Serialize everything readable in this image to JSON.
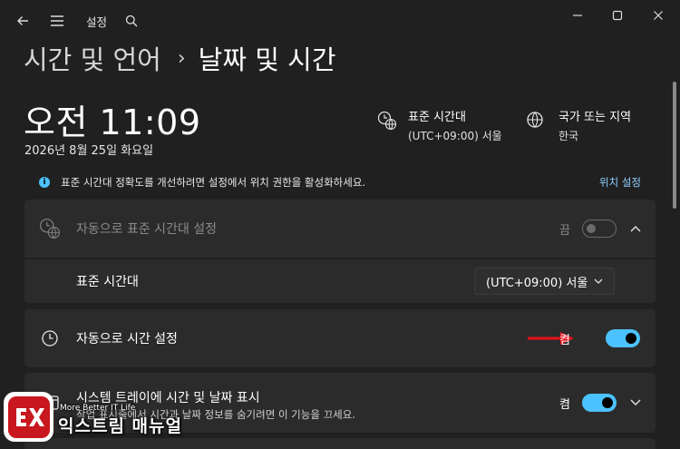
{
  "nav": {
    "title": "설정",
    "back_icon": "back-arrow-icon",
    "menu_icon": "hamburger-menu-icon",
    "search_icon": "search-icon"
  },
  "breadcrumb": {
    "parent": "시간 및 언어",
    "separator": "›",
    "current": "날짜 및 시간"
  },
  "clock": {
    "time": "오전 11:09",
    "date": "2026년 8월 25일 화요일"
  },
  "timezone_info": {
    "label": "표준 시간대",
    "value": "(UTC+09:00) 서울",
    "icon": "timezone-globe-icon"
  },
  "region_info": {
    "label": "국가 또는 지역",
    "value": "한국",
    "icon": "globe-icon"
  },
  "notice": {
    "text": "표준 시간대 정확도를 개선하려면 설정에서 위치 권한을 활성화하세요.",
    "link": "위치 설정"
  },
  "auto_timezone": {
    "label": "자동으로 표준 시간대 설정",
    "state": "끔"
  },
  "timezone_row": {
    "label": "표준 시간대",
    "selected": "(UTC+09:00) 서울"
  },
  "auto_time": {
    "label": "자동으로 시간 설정",
    "state": "켬"
  },
  "systray": {
    "label": "시스템 트레이에 시간 및 날짜 표시",
    "desc": "작업 표시줄에서 시간과 날짜 정보를 숨기려면 이 기능을 끄세요.",
    "state": "켬"
  },
  "watermark": {
    "tagline": "More Better IT Life",
    "brand": "익스트림 매뉴얼"
  },
  "colors": {
    "accent": "#4cc2ff",
    "background": "#202020",
    "card": "#2b2b2b",
    "arrow": "#e8101a"
  }
}
